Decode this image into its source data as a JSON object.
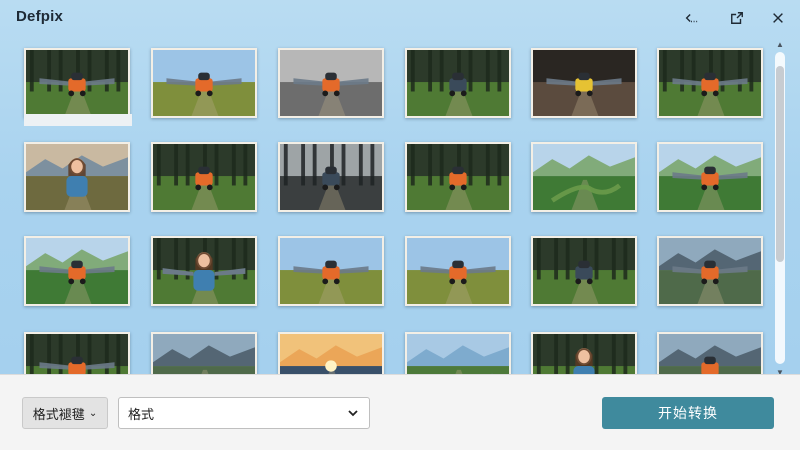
{
  "app": {
    "title": "Defpix"
  },
  "window_controls": {
    "back_icon": "back-arrow-icon",
    "export_icon": "export-icon",
    "close_icon": "close-icon"
  },
  "gallery": {
    "thumbnails": [
      {
        "subject": "flying-car-forest"
      },
      {
        "subject": "flying-car-meadow"
      },
      {
        "subject": "flying-car-city-street"
      },
      {
        "subject": "robot-forest-path"
      },
      {
        "subject": "flying-car-bokeh"
      },
      {
        "subject": "flying-car-forest-clearing"
      },
      {
        "subject": "girl-by-river"
      },
      {
        "subject": "robot-car-forest-path"
      },
      {
        "subject": "robot-foggy-forest"
      },
      {
        "subject": "girl-holding-toy-car"
      },
      {
        "subject": "river-valley-landscape"
      },
      {
        "subject": "winged-car-valley"
      },
      {
        "subject": "winged-car-hills"
      },
      {
        "subject": "girl-with-wings-forest"
      },
      {
        "subject": "winged-car-dirt-road"
      },
      {
        "subject": "winged-car-field"
      },
      {
        "subject": "girl-on-robot-forest"
      },
      {
        "subject": "winged-car-mountains"
      },
      {
        "subject": "flying-car-forest-road"
      },
      {
        "subject": "mountain-river-landscape"
      },
      {
        "subject": "sunset-river-landscape"
      },
      {
        "subject": "lake-valley-landscape"
      },
      {
        "subject": "girl-portrait-forest"
      },
      {
        "subject": "car-mountain-valley"
      }
    ]
  },
  "toolbar": {
    "format_group_label": "格式褪毽",
    "format_select_value": "格式",
    "start_button_label": "开始转换"
  },
  "colors": {
    "background": "#a9d3ef",
    "toolbar_bg": "#f4f4f4",
    "accent_button": "#3f8a9d",
    "thumb_border": "#f3efe6"
  }
}
